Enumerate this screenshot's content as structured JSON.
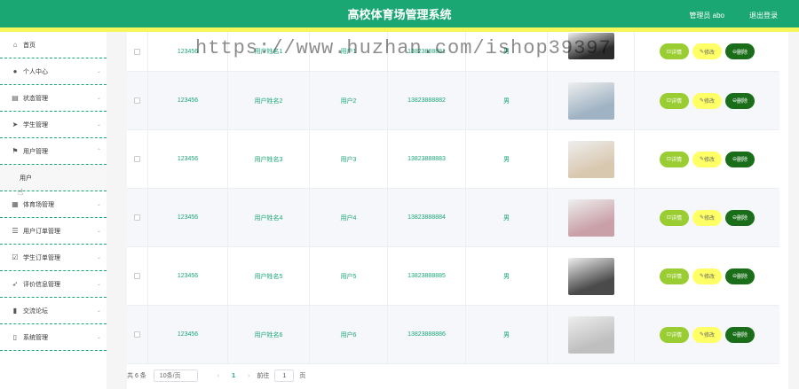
{
  "header": {
    "title": "高校体育场管理系统",
    "user": "管理员 abo",
    "logout": "退出登录"
  },
  "sidebar": {
    "items": [
      {
        "label": "首页",
        "icon": "home-icon",
        "glyph": "⌂"
      },
      {
        "label": "个人中心",
        "icon": "user-icon",
        "glyph": "●"
      },
      {
        "label": "状态管理",
        "icon": "briefcase-icon",
        "glyph": "▤"
      },
      {
        "label": "学生管理",
        "icon": "send-icon",
        "glyph": "➤"
      },
      {
        "label": "用户管理",
        "icon": "flag-icon",
        "glyph": "⚑"
      },
      {
        "label": "用户",
        "sub": true
      },
      {
        "label": "体育场管理",
        "icon": "calendar-icon",
        "glyph": "▦"
      },
      {
        "label": "用户订单管理",
        "icon": "list-icon",
        "glyph": "☰"
      },
      {
        "label": "学生订单管理",
        "icon": "checkbox-icon",
        "glyph": "☑"
      },
      {
        "label": "评价信息管理",
        "icon": "navigation-icon",
        "glyph": "➶"
      },
      {
        "label": "交流论坛",
        "icon": "chart-icon",
        "glyph": "▮"
      },
      {
        "label": "系统管理",
        "icon": "phone-icon",
        "glyph": "▯"
      }
    ]
  },
  "table": {
    "rows": [
      {
        "id": "123456",
        "name": "用户姓名1",
        "account": "用户1",
        "phone": "13823888881",
        "sex": "男",
        "avatar_color": "#2b2b2b"
      },
      {
        "id": "123456",
        "name": "用户姓名2",
        "account": "用户2",
        "phone": "13823888882",
        "sex": "男",
        "avatar_color": "#9fb3c4"
      },
      {
        "id": "123456",
        "name": "用户姓名3",
        "account": "用户3",
        "phone": "13823888883",
        "sex": "男",
        "avatar_color": "#d9c8b0"
      },
      {
        "id": "123456",
        "name": "用户姓名4",
        "account": "用户4",
        "phone": "13823888884",
        "sex": "男",
        "avatar_color": "#c9a0a8"
      },
      {
        "id": "123456",
        "name": "用户姓名5",
        "account": "用户5",
        "phone": "13823888885",
        "sex": "男",
        "avatar_color": "#4a4a4a"
      },
      {
        "id": "123456",
        "name": "用户姓名6",
        "account": "用户6",
        "phone": "13823888886",
        "sex": "男",
        "avatar_color": "#bfbfbf"
      }
    ],
    "actions": {
      "detail": "详情",
      "edit": "修改",
      "delete": "删除"
    }
  },
  "pager": {
    "total": "共 6 条",
    "size": "10条/页",
    "page": "1",
    "goto_label": "前往",
    "goto_value": "1",
    "goto_suffix": "页"
  },
  "watermark": "https://www.huzhan.com/ishop39397"
}
